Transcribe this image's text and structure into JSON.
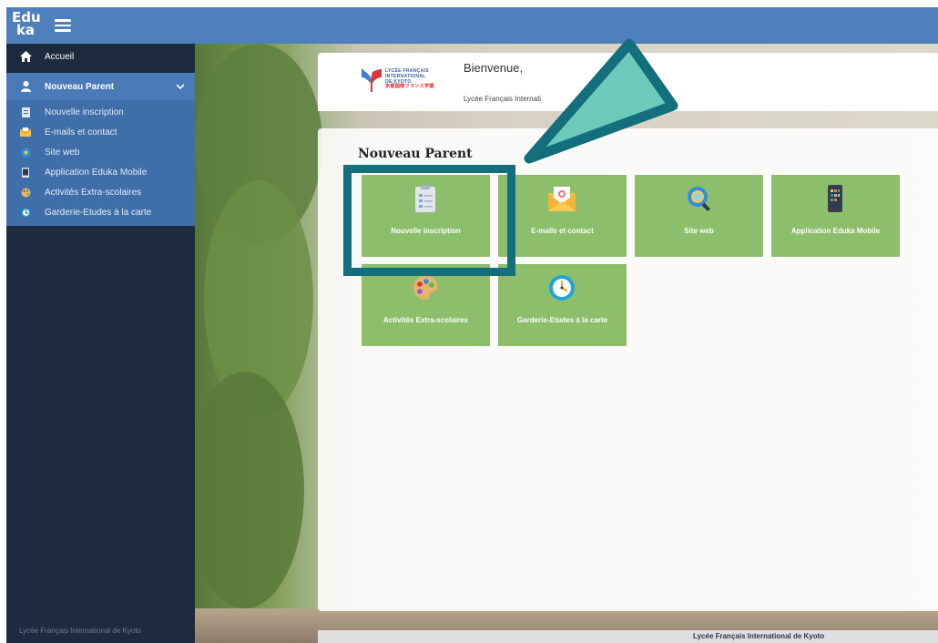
{
  "app": {
    "logo": "Edu\nka"
  },
  "sidebar": {
    "home": {
      "label": "Accueil",
      "icon": "home-icon"
    },
    "parent": {
      "label": "Nouveau Parent",
      "icon": "user-icon"
    },
    "items": [
      {
        "label": "Nouvelle inscription",
        "icon": "document-icon"
      },
      {
        "label": "E-mails et contact",
        "icon": "mail-icon"
      },
      {
        "label": "Site web",
        "icon": "globe-icon"
      },
      {
        "label": "Application Eduka Mobile",
        "icon": "phone-icon"
      },
      {
        "label": "Activités Extra-scolaires",
        "icon": "palette-icon"
      },
      {
        "label": "Garderie-Etudes à la carte",
        "icon": "clock-icon"
      }
    ],
    "footer": "Lycée Français International de Kyoto"
  },
  "header": {
    "logo_lines": [
      "LYCÉE FRANÇAIS",
      "INTERNATIONAL",
      "DE KYOTO",
      "京都国際フランス学園"
    ],
    "welcome": "Bienvenue,",
    "school": "Lycée Français Internati"
  },
  "main": {
    "title": "Nouveau Parent",
    "tiles": [
      {
        "label": "Nouvelle inscription",
        "icon": "clipboard-icon"
      },
      {
        "label": "E-mails et contact",
        "icon": "envelope-icon"
      },
      {
        "label": "Site web",
        "icon": "globe-search-icon"
      },
      {
        "label": "Application Eduka Mobile",
        "icon": "smartphone-icon"
      },
      {
        "label": "Activités Extra-scolaires",
        "icon": "paint-palette-icon"
      },
      {
        "label": "Garderie-Etudes à la carte",
        "icon": "clock-icon"
      }
    ]
  },
  "footer": {
    "text": "Lycée Français International de Kyoto"
  },
  "colors": {
    "topbar": "#4e80bd",
    "sidebar": "#1d2b3e",
    "submenu": "#3f6ea9",
    "tile": "#8cbe6b",
    "highlight": "#136f7c",
    "arrow_fill": "#6ecbbb"
  }
}
